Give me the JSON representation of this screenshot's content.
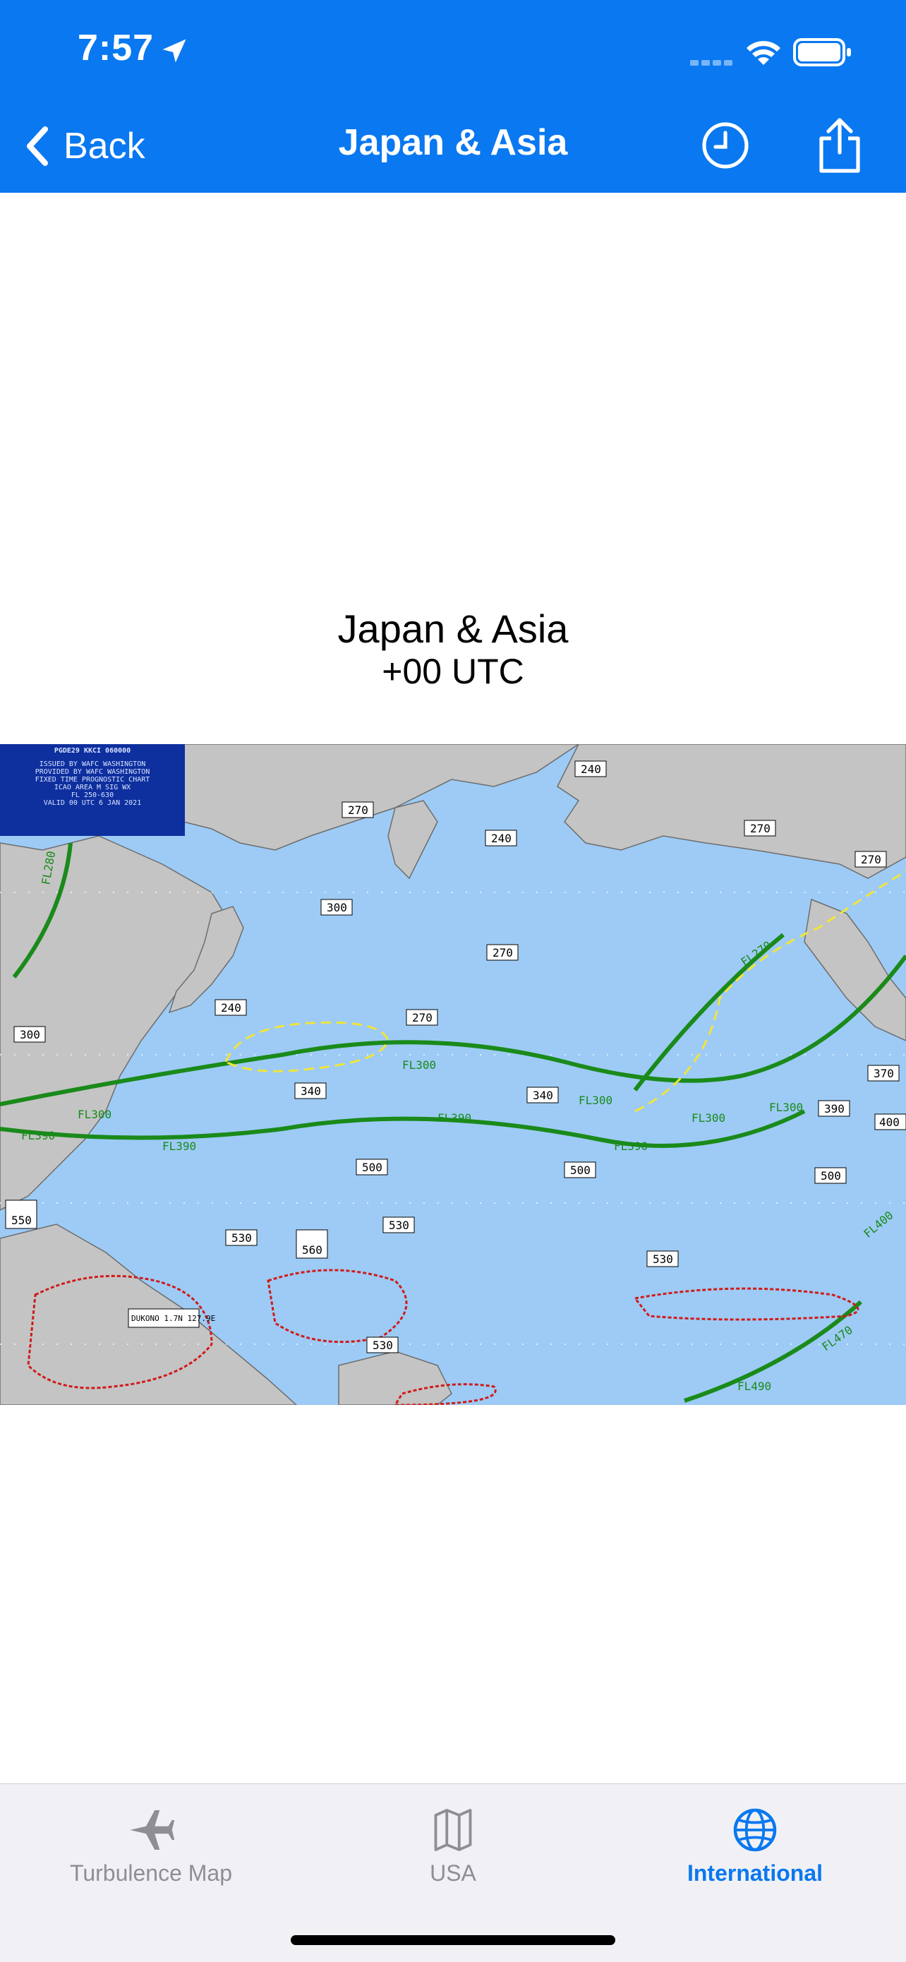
{
  "status_bar": {
    "time": "7:57"
  },
  "nav": {
    "back_label": "Back",
    "title": "Japan & Asia"
  },
  "content": {
    "title": "Japan & Asia",
    "subtitle": "+00 UTC"
  },
  "chart_info": {
    "header": "PGDE29 KKCI 060000",
    "lines": [
      "ISSUED BY WAFC WASHINGTON",
      "PROVIDED BY WAFC WASHINGTON",
      "FIXED TIME PROGNOSTIC CHART",
      "ICAO AREA M SIG WX",
      "FL 250-630",
      "VALID 00 UTC  6 JAN 2021"
    ]
  },
  "chart_labels": {
    "flight_levels": [
      "FL280",
      "FL300",
      "FL390",
      "FL390",
      "FL300",
      "FL390",
      "FL300",
      "FL270",
      "FL390",
      "FL300",
      "FL300",
      "FL400",
      "FL470",
      "FL490"
    ],
    "boxes": [
      "240",
      "270",
      "240",
      "270",
      "270",
      "270",
      "300",
      "270",
      "340",
      "300",
      "240",
      "340",
      "500",
      "500",
      "500",
      "530",
      "530",
      "530",
      "530",
      "550",
      "560",
      "370",
      "390",
      "400"
    ],
    "volcano": "DUKONO 1.7N 127.9E"
  },
  "colors": {
    "header_blue": "#0a78f0",
    "sea": "#9dcbf5",
    "land": "#c4c4c4",
    "jet": "#1a8a1a",
    "turbulence": "#f0e53a",
    "cb": "#d11a1a"
  },
  "tabs": [
    {
      "label": "Turbulence Map",
      "icon": "airplane-icon",
      "active": false
    },
    {
      "label": "USA",
      "icon": "map-icon",
      "active": false
    },
    {
      "label": "International",
      "icon": "globe-icon",
      "active": true
    }
  ]
}
